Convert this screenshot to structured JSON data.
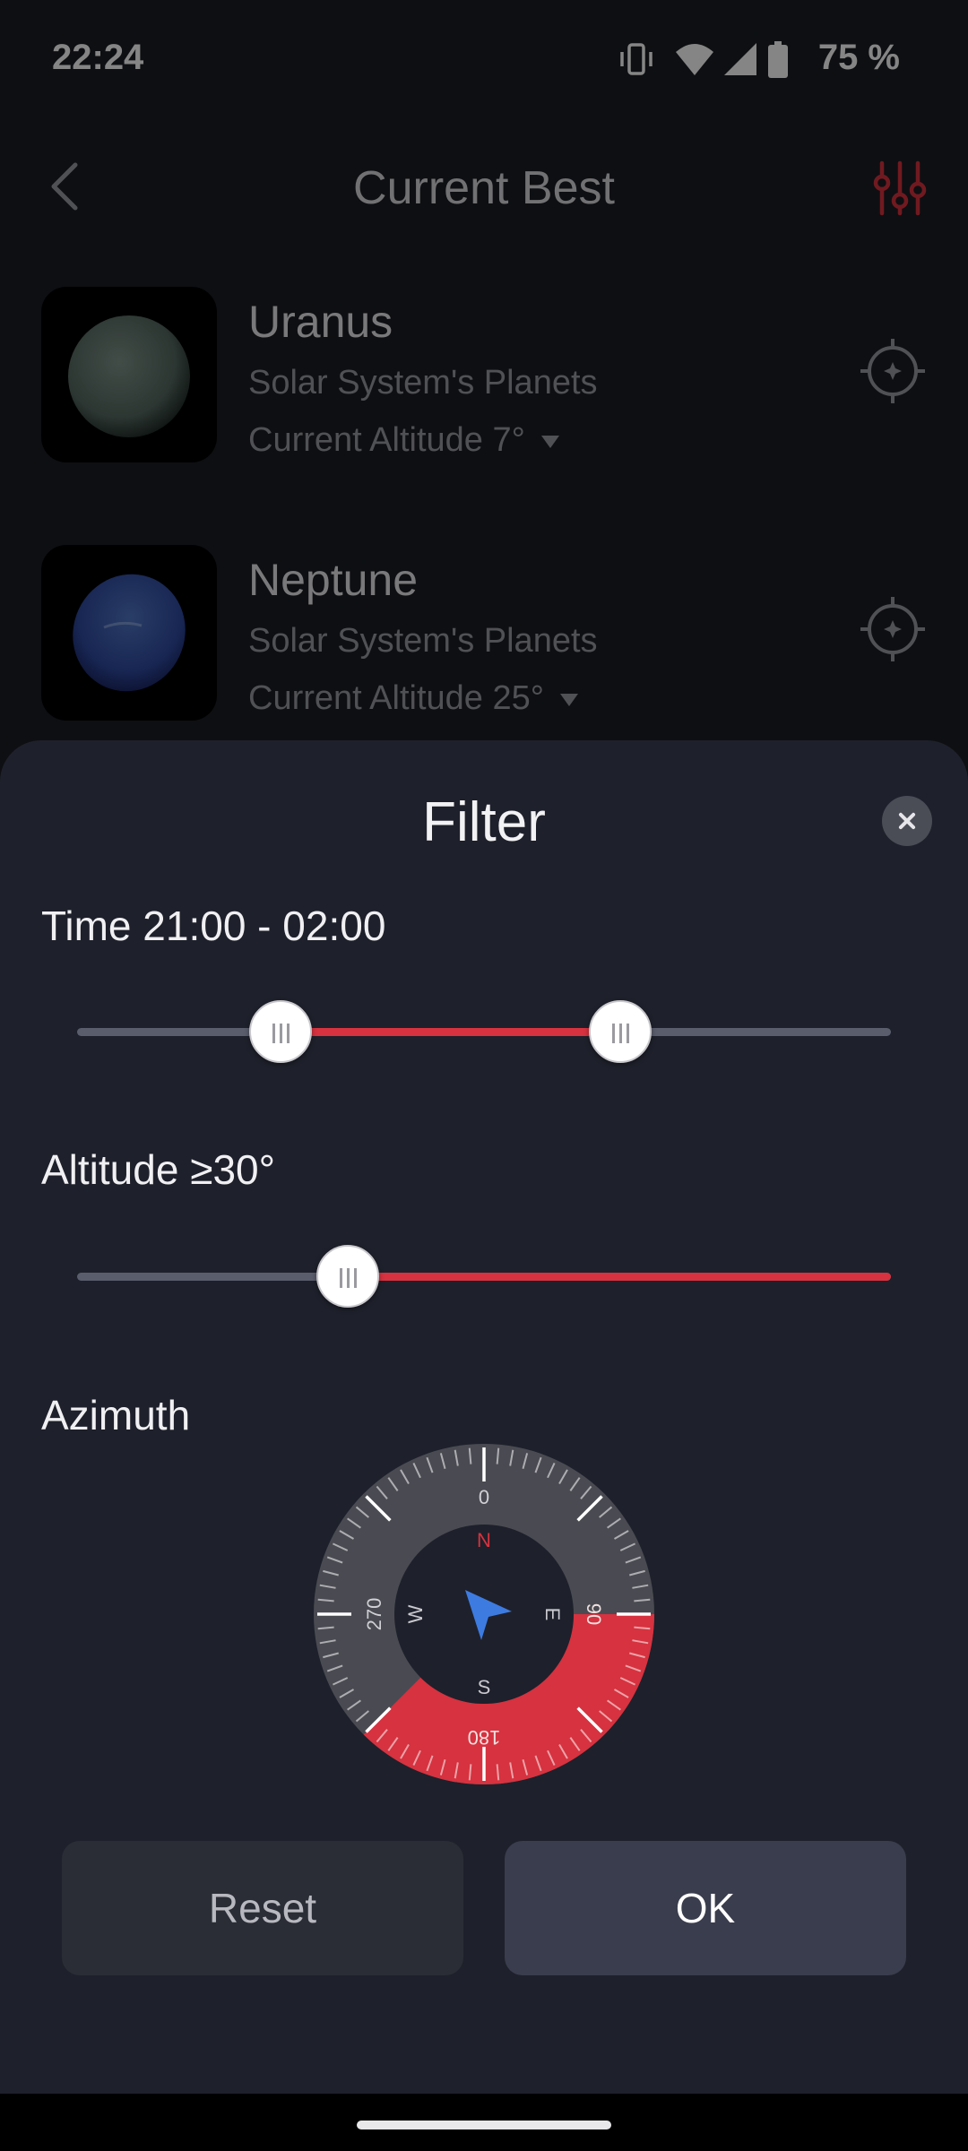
{
  "status_bar": {
    "time": "22:24",
    "battery": "75 %",
    "icons": [
      "vibrate-icon",
      "wifi-icon",
      "signal-icon",
      "battery-icon"
    ]
  },
  "header": {
    "title": "Current Best",
    "back_icon": "chevron-left-icon",
    "filter_icon": "sliders-icon"
  },
  "list": [
    {
      "name": "Uranus",
      "category": "Solar System's Planets",
      "altitude": "Current Altitude 7°",
      "target_icon": "crosshair-icon"
    },
    {
      "name": "Neptune",
      "category": "Solar System's Planets",
      "altitude": "Current Altitude 25°",
      "target_icon": "crosshair-icon"
    }
  ],
  "filter": {
    "title": "Filter",
    "close_icon": "close-icon",
    "time_label": "Time 21:00 - 02:00",
    "time_range": {
      "low": 0.25,
      "high": 0.667
    },
    "altitude_label": "Altitude ≥30°",
    "altitude_level": 0.333,
    "azimuth_label": "Azimuth",
    "compass": {
      "degree_labels": [
        "0",
        "90",
        "180",
        "270"
      ],
      "cardinals": [
        "N",
        "E",
        "S",
        "W"
      ],
      "selected_range_deg": [
        90,
        225
      ]
    },
    "reset_label": "Reset",
    "ok_label": "OK"
  },
  "colors": {
    "accent": "#d6323f",
    "sheet": "#1e202b",
    "background": "#1b1d23",
    "pointer": "#3d7be0"
  }
}
